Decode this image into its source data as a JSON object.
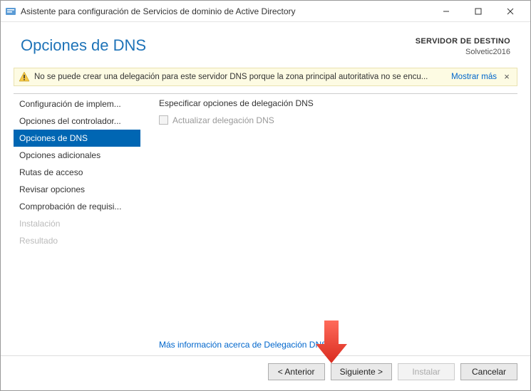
{
  "titlebar": {
    "title": "Asistente para configuración de Servicios de dominio de Active Directory"
  },
  "header": {
    "page_title": "Opciones de DNS",
    "dest_label": "SERVIDOR DE DESTINO",
    "dest_value": "Solvetic2016"
  },
  "warning": {
    "text": "No se puede crear una delegación para este servidor DNS porque la zona principal autoritativa no se encu...",
    "more": "Mostrar más"
  },
  "sidebar": {
    "items": [
      {
        "label": "Configuración de implem..."
      },
      {
        "label": "Opciones del controlador..."
      },
      {
        "label": "Opciones de DNS"
      },
      {
        "label": "Opciones adicionales"
      },
      {
        "label": "Rutas de acceso"
      },
      {
        "label": "Revisar opciones"
      },
      {
        "label": "Comprobación de requisi..."
      },
      {
        "label": "Instalación"
      },
      {
        "label": "Resultado"
      }
    ]
  },
  "content": {
    "heading": "Especificar opciones de delegación DNS",
    "checkbox_label": "Actualizar delegación DNS",
    "link": "Más información acerca de Delegación DNS"
  },
  "footer": {
    "prev": "< Anterior",
    "next": "Siguiente >",
    "install": "Instalar",
    "cancel": "Cancelar"
  }
}
